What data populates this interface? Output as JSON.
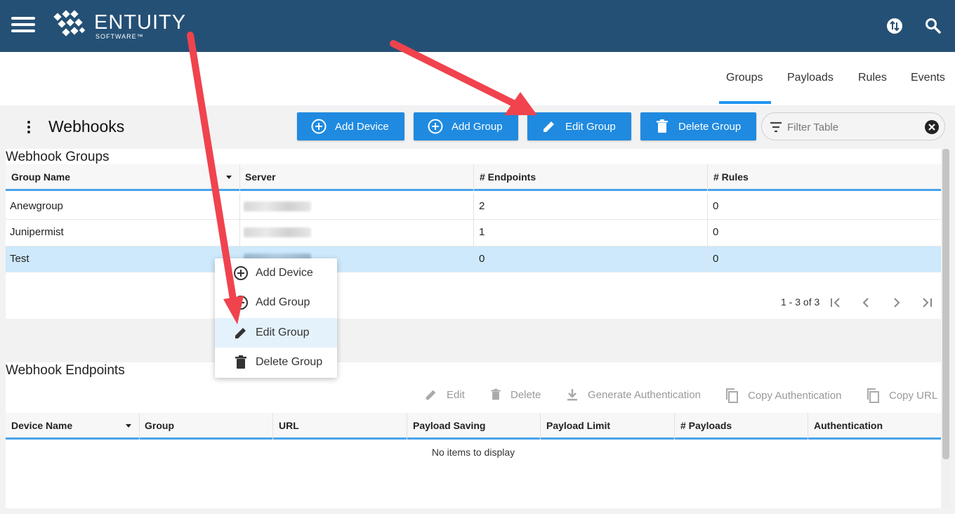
{
  "app": {
    "brand": "ENTUITY",
    "brand_sub": "SOFTWARE™"
  },
  "nav_tabs": [
    {
      "label": "Groups",
      "active": true
    },
    {
      "label": "Payloads",
      "active": false
    },
    {
      "label": "Rules",
      "active": false
    },
    {
      "label": "Events",
      "active": false
    }
  ],
  "page": {
    "title": "Webhooks"
  },
  "toolbar": {
    "add_device": "Add Device",
    "add_group": "Add Group",
    "edit_group": "Edit Group",
    "delete_group": "Delete Group",
    "filter_placeholder": "Filter Table"
  },
  "groups_table": {
    "title": "Webhook Groups",
    "columns": [
      "Group Name",
      "Server",
      "# Endpoints",
      "# Rules"
    ],
    "rows": [
      {
        "name": "Anewgroup",
        "endpoints": "2",
        "rules": "0"
      },
      {
        "name": "Junipermist",
        "endpoints": "1",
        "rules": "0"
      },
      {
        "name": "Test",
        "endpoints": "0",
        "rules": "0",
        "selected": true
      }
    ],
    "pager": "1 - 3 of 3"
  },
  "context_menu": {
    "items": [
      "Add Device",
      "Add Group",
      "Edit Group",
      "Delete Group"
    ],
    "highlighted": "Edit Group"
  },
  "endpoints_table": {
    "title": "Webhook Endpoints",
    "actions": [
      "Edit",
      "Delete",
      "Generate Authentication",
      "Copy Authentication",
      "Copy URL"
    ],
    "columns": [
      "Device Name",
      "Group",
      "URL",
      "Payload Saving",
      "Payload Limit",
      "# Payloads",
      "Authentication"
    ],
    "empty_text": "No items to display"
  },
  "colors": {
    "header_bg": "#255075",
    "primary_button": "#1f8ae0",
    "accent_underline": "#2196f3",
    "selected_row": "#cde9fb",
    "annotation_arrow": "#f0434e"
  },
  "icons": [
    "menu-icon",
    "swap-icon",
    "search-icon",
    "add-circle-icon",
    "pencil-icon",
    "trash-icon",
    "filter-icon",
    "clear-icon",
    "sort-down-icon",
    "first-page-icon",
    "prev-page-icon",
    "next-page-icon",
    "last-page-icon",
    "download-icon",
    "copy-icon"
  ]
}
